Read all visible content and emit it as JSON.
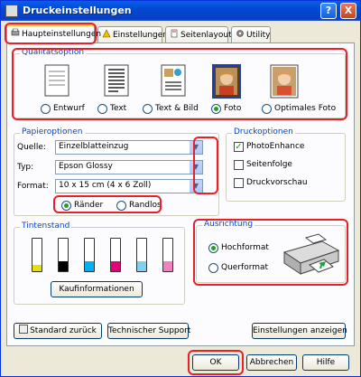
{
  "window": {
    "title": "Druckeinstellungen",
    "help": "?",
    "close": "X"
  },
  "tabs": [
    {
      "label": "Haupteinstellungen"
    },
    {
      "label": "Einstellungen"
    },
    {
      "label": "Seitenlayout"
    },
    {
      "label": "Utility"
    }
  ],
  "quality": {
    "group_label": "Qualitätsoption",
    "options": [
      {
        "label": "Entwurf",
        "selected": false
      },
      {
        "label": "Text",
        "selected": false
      },
      {
        "label": "Text & Bild",
        "selected": false
      },
      {
        "label": "Foto",
        "selected": true
      },
      {
        "label": "Optimales Foto",
        "selected": false
      }
    ]
  },
  "paper": {
    "group_label": "Papieroptionen",
    "source_label": "Quelle:",
    "source_value": "Einzelblatteinzug",
    "type_label": "Typ:",
    "type_value": "Epson Glossy",
    "format_label": "Format:",
    "format_value": "10 x 15 cm (4 x 6 Zoll)",
    "margins": [
      {
        "label": "Ränder",
        "selected": true
      },
      {
        "label": "Randlos",
        "selected": false
      }
    ]
  },
  "print_options": {
    "group_label": "Druckoptionen",
    "items": [
      {
        "label": "PhotoEnhance",
        "checked": true
      },
      {
        "label": "Seitenfolge",
        "checked": false
      },
      {
        "label": "Druckvorschau",
        "checked": false
      }
    ]
  },
  "ink": {
    "group_label": "Tintenstand",
    "levels": [
      {
        "color": "#e8e000",
        "level": 0.2
      },
      {
        "color": "#000000",
        "level": 0.3
      },
      {
        "color": "#00b0f0",
        "level": 0.3
      },
      {
        "color": "#e0007a",
        "level": 0.3
      },
      {
        "color": "#80d0f0",
        "level": 0.3
      },
      {
        "color": "#f080c0",
        "level": 0.3
      }
    ],
    "info_button": "Kaufinformationen"
  },
  "orientation": {
    "group_label": "Ausrichtung",
    "options": [
      {
        "label": "Hochformat",
        "selected": true
      },
      {
        "label": "Querformat",
        "selected": false
      }
    ]
  },
  "bottom": {
    "reset_button": "Standard zurück",
    "support_button": "Technischer Support",
    "show_settings_button": "Einstellungen anzeigen"
  },
  "dialog": {
    "ok": "OK",
    "cancel": "Abbrechen",
    "help": "Hilfe"
  },
  "colors": {
    "highlight": "#e8202a",
    "group_label": "#0046d5",
    "title_bar": "#0a5ee8"
  }
}
